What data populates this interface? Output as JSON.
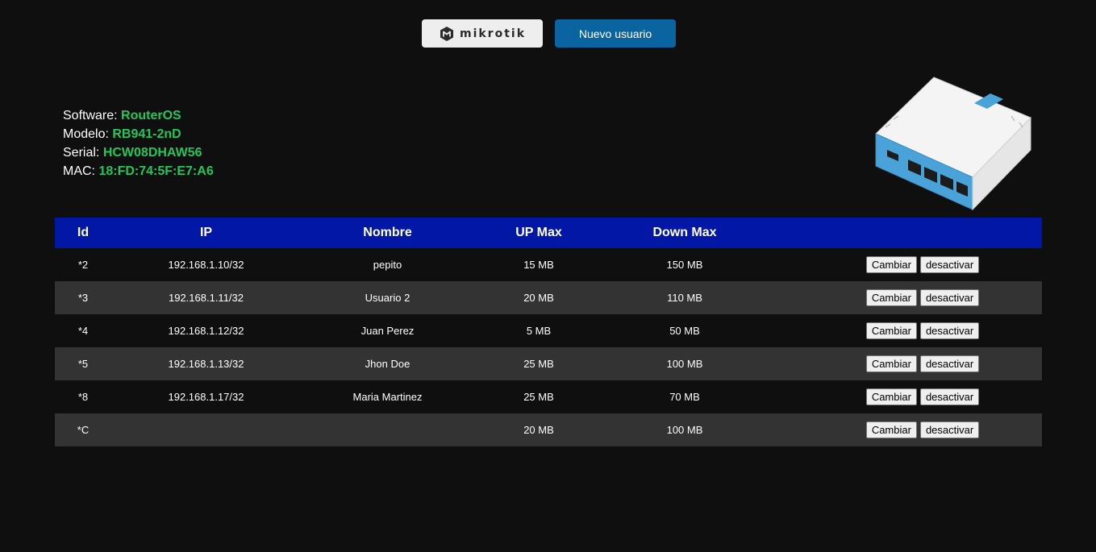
{
  "header": {
    "brand_name": "MikroTik",
    "brand_text": "mikrotik",
    "new_user_label": "Nuevo usuario"
  },
  "device": {
    "software_label": "Software:",
    "software": "RouterOS",
    "model_label": "Modelo:",
    "model": "RB941-2nD",
    "serial_label": "Serial:",
    "serial": "HCW08DHAW56",
    "mac_label": "MAC:",
    "mac": "18:FD:74:5F:E7:A6"
  },
  "table": {
    "columns": [
      "Id",
      "IP",
      "Nombre",
      "UP Max",
      "Down Max"
    ],
    "rows": [
      {
        "id": "*2",
        "ip": "192.168.1.10/32",
        "name": "pepito",
        "up": "15 MB",
        "down": "150 MB"
      },
      {
        "id": "*3",
        "ip": "192.168.1.11/32",
        "name": "Usuario 2",
        "up": "20 MB",
        "down": "110 MB"
      },
      {
        "id": "*4",
        "ip": "192.168.1.12/32",
        "name": "Juan Perez",
        "up": "5 MB",
        "down": "50 MB"
      },
      {
        "id": "*5",
        "ip": "192.168.1.13/32",
        "name": "Jhon Doe",
        "up": "25 MB",
        "down": "100 MB"
      },
      {
        "id": "*8",
        "ip": "192.168.1.17/32",
        "name": "Maria Martinez",
        "up": "25 MB",
        "down": "70 MB"
      },
      {
        "id": "*C",
        "ip": "",
        "name": "",
        "up": "20 MB",
        "down": "100 MB"
      }
    ],
    "change_label": "Cambiar",
    "disable_label": "desactivar"
  },
  "colors": {
    "background": "#0f0f0f",
    "header_row": "#0217a6",
    "alt_row": "#333333",
    "accent_green": "#22c55e",
    "primary_button": "#0a64a0"
  }
}
